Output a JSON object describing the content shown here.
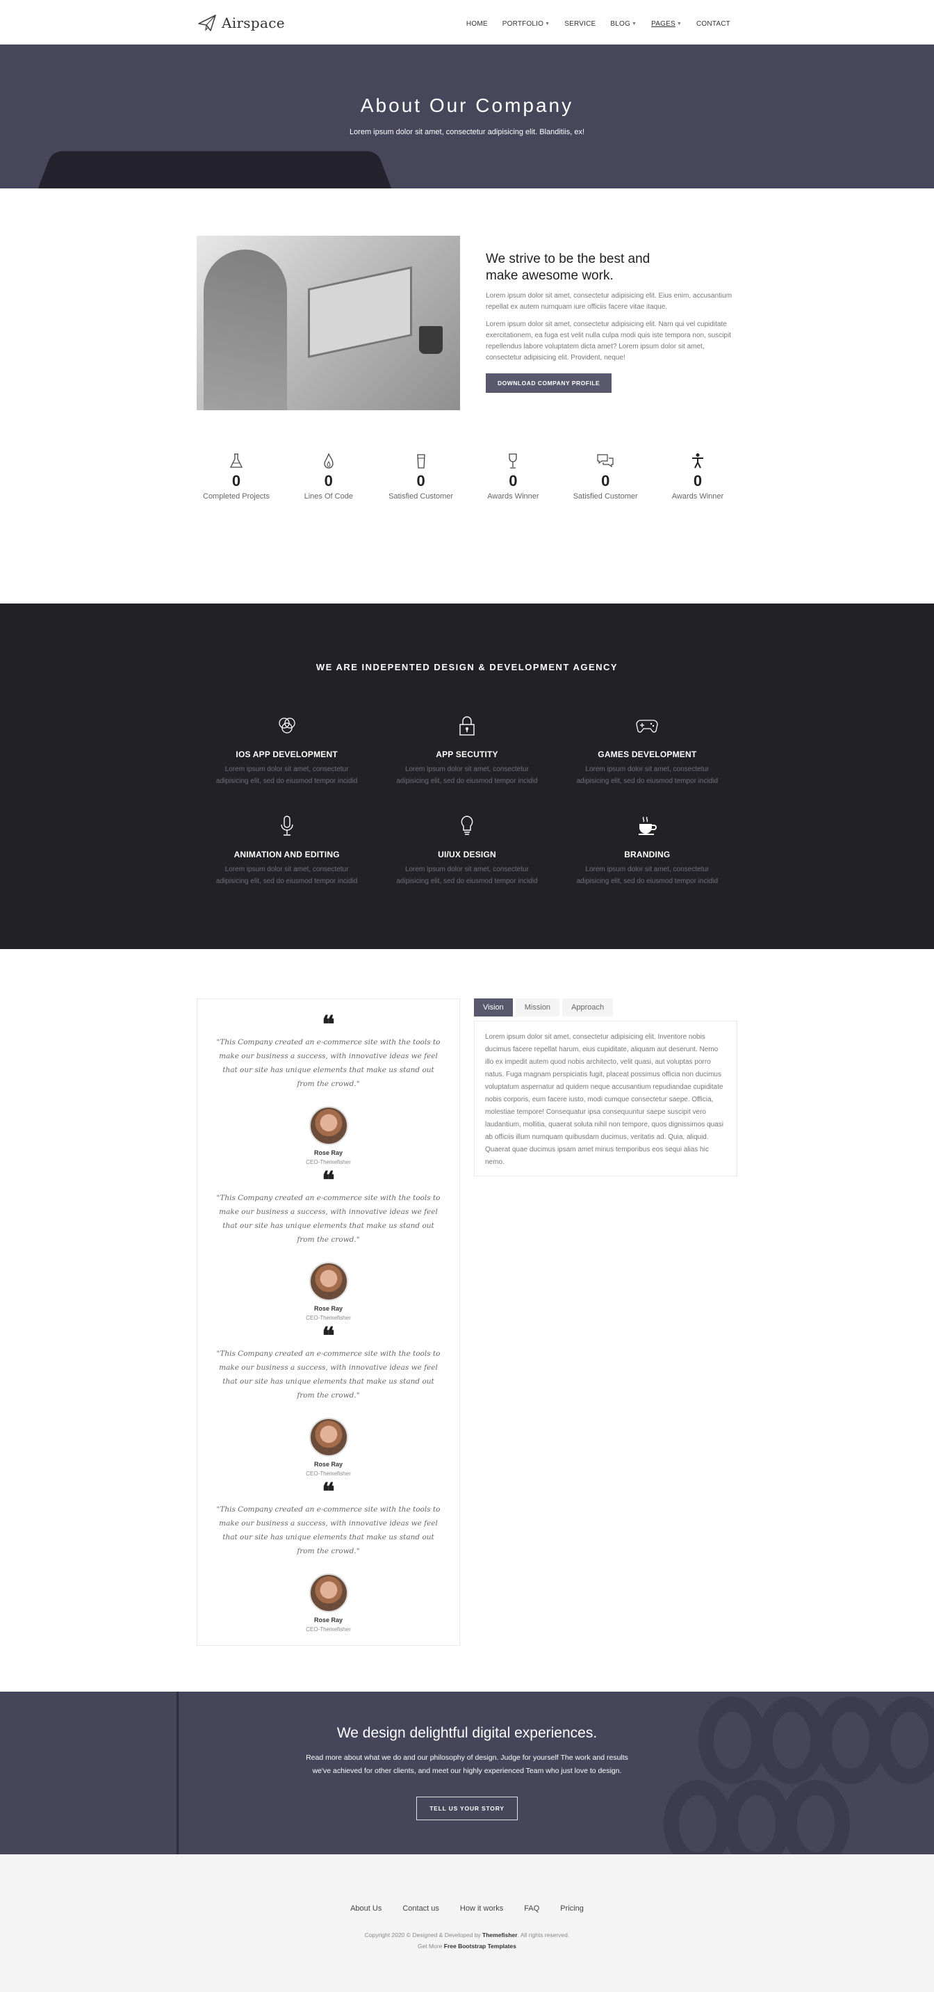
{
  "brand": {
    "name": "Airspace"
  },
  "nav": {
    "items": [
      {
        "label": "HOME",
        "dropdown": false
      },
      {
        "label": "PORTFOLIO",
        "dropdown": true
      },
      {
        "label": "SERVICE",
        "dropdown": false
      },
      {
        "label": "BLOG",
        "dropdown": true
      },
      {
        "label": "PAGES",
        "dropdown": true,
        "active": true
      },
      {
        "label": "CONTACT",
        "dropdown": false
      }
    ]
  },
  "hero": {
    "title": "About Our Company",
    "subtitle": "Lorem ipsum dolor sit amet, consectetur adipisicing elit. Blanditiis, ex!"
  },
  "about": {
    "title": "We strive to be the best and make awesome work.",
    "paragraph1": "Lorem ipsum dolor sit amet, consectetur adipisicing elit. Eius enim, accusantium repellat ex autem numquam iure officiis facere vitae itaque.",
    "paragraph2": "Lorem ipsum dolor sit amet, consectetur adipisicing elit. Nam qui vel cupiditate exercitationem, ea fuga est velit nulla culpa modi quis iste tempora non, suscipit repellendus labore voluptatem dicta amet? Lorem ipsum dolor sit amet, consectetur adipisicing elit. Provident, neque!",
    "button": "DOWNLOAD COMPANY PROFILE"
  },
  "stats": [
    {
      "icon": "flask-icon",
      "value": "0",
      "label": "Completed Projects"
    },
    {
      "icon": "flame-icon",
      "value": "0",
      "label": "Lines Of Code"
    },
    {
      "icon": "cup-icon",
      "value": "0",
      "label": "Satisfied Customer"
    },
    {
      "icon": "wine-glass-icon",
      "value": "0",
      "label": "Awards Winner"
    },
    {
      "icon": "chat-bubbles-icon",
      "value": "0",
      "label": "Satisfied Customer"
    },
    {
      "icon": "person-icon",
      "value": "0",
      "label": "Awards Winner"
    }
  ],
  "services": {
    "heading": "WE ARE INDEPENTED DESIGN & DEVELOPMENT AGENCY",
    "items": [
      {
        "icon": "circles-icon",
        "title": "IOS APP DEVELOPMENT",
        "desc": "Lorem ipsum dolor sit amet, consectetur adipisicing elit, sed do eiusmod tempor incidid"
      },
      {
        "icon": "lock-icon",
        "title": "APP SECUTITY",
        "desc": "Lorem ipsum dolor sit amet, consectetur adipisicing elit, sed do eiusmod tempor incidid"
      },
      {
        "icon": "gamepad-icon",
        "title": "GAMES DEVELOPMENT",
        "desc": "Lorem ipsum dolor sit amet, consectetur adipisicing elit, sed do eiusmod tempor incidid"
      },
      {
        "icon": "microphone-icon",
        "title": "ANIMATION AND EDITING",
        "desc": "Lorem ipsum dolor sit amet, consectetur adipisicing elit, sed do eiusmod tempor incidid"
      },
      {
        "icon": "lightbulb-icon",
        "title": "UI/UX DESIGN",
        "desc": "Lorem ipsum dolor sit amet, consectetur adipisicing elit, sed do eiusmod tempor incidid"
      },
      {
        "icon": "coffee-icon",
        "title": "BRANDING",
        "desc": "Lorem ipsum dolor sit amet, consectetur adipisicing elit, sed do eiusmod tempor incidid"
      }
    ]
  },
  "testimonials": [
    {
      "quote": "\"This Company created an e-commerce site with the tools to make our business a success, with innovative ideas we feel that our site has unique elements that make us stand out from the crowd.\"",
      "name": "Rose Ray",
      "role": "CEO-Themefisher"
    },
    {
      "quote": "\"This Company created an e-commerce site with the tools to make our business a success, with innovative ideas we feel that our site has unique elements that make us stand out from the crowd.\"",
      "name": "Rose Ray",
      "role": "CEO-Themefisher"
    },
    {
      "quote": "\"This Company created an e-commerce site with the tools to make our business a success, with innovative ideas we feel that our site has unique elements that make us stand out from the crowd.\"",
      "name": "Rose Ray",
      "role": "CEO-Themefisher"
    },
    {
      "quote": "\"This Company created an e-commerce site with the tools to make our business a success, with innovative ideas we feel that our site has unique elements that make us stand out from the crowd.\"",
      "name": "Rose Ray",
      "role": "CEO-Themefisher"
    }
  ],
  "tabs": {
    "items": [
      {
        "label": "Vision",
        "active": true
      },
      {
        "label": "Mission",
        "active": false
      },
      {
        "label": "Approach",
        "active": false
      }
    ],
    "content": "Lorem ipsum dolor sit amet, consectetur adipisicing elit. Inventore nobis ducimus facere repellat harum, eius cupiditate, aliquam aut deserunt. Nemo illo ex impedit autem quod nobis architecto, velit quasi, aut voluptas porro natus. Fuga magnam perspiciatis fugit, placeat possimus officia non ducimus voluptatum aspernatur ad quidem neque accusantium repudiandae cupiditate nobis corporis, eum facere iusto, modi cumque consectetur saepe. Officia, molestiae tempore! Consequatur ipsa consequuntur saepe suscipit vero laudantium, mollitia, quaerat soluta nihil non tempore, quos dignissimos quasi ab officiis illum numquam quibusdam ducimus, veritatis ad. Quia, aliquid. Quaerat quae ducimus ipsam amet minus temporibus eos sequi alias hic nemo."
  },
  "cta": {
    "title": "We design delightful digital experiences.",
    "text": "Read more about what we do and our philosophy of design. Judge for yourself The work and results we've achieved for other clients, and meet our highly experienced Team who just love to design.",
    "button": "TELL US YOUR STORY"
  },
  "footer": {
    "links": [
      "About Us",
      "Contact us",
      "How it works",
      "FAQ",
      "Pricing"
    ],
    "copyright_prefix": "Copyright 2020 © Designed & Developed by",
    "copyright_brand": "Themefisher",
    "copyright_suffix": ". All rights reserved.",
    "more_prefix": "Get More",
    "more_link": "Free Bootstrap Templates"
  },
  "colors": {
    "accent": "#5a586c",
    "hero_bg": "#48465a",
    "services_bg": "#222226",
    "footer_bg": "#f4f4f4"
  }
}
